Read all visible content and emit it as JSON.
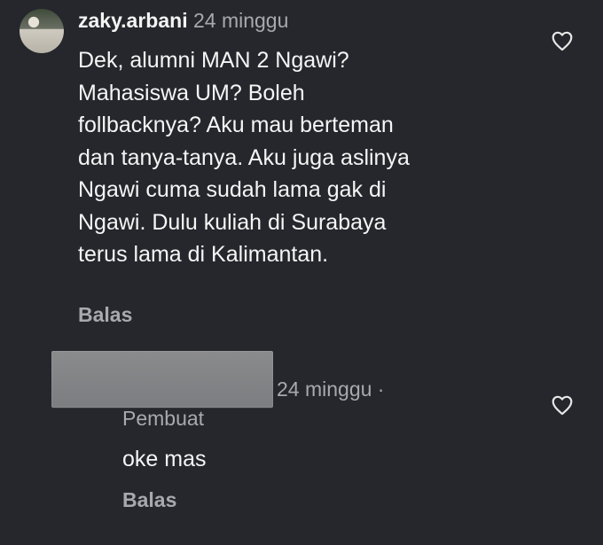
{
  "comment": {
    "username": "zaky.arbani",
    "time": "24 minggu",
    "body_lines": [
      "Dek, alumni MAN 2 Ngawi?",
      "Mahasiswa UM? Boleh",
      "follbacknya? Aku mau berteman",
      "dan tanya-tanya. Aku juga aslinya",
      "Ngawi cuma sudah lama gak di",
      "Ngawi. Dulu kuliah di Surabaya",
      "terus lama di Kalimantan."
    ],
    "reply_label": "Balas",
    "like_icon": "heart-outline-icon"
  },
  "reply": {
    "username_redacted": true,
    "time": "24 minggu ·",
    "badge": "Pembuat",
    "body": "oke mas",
    "reply_label": "Balas",
    "like_icon": "heart-outline-icon"
  },
  "colors": {
    "background": "#25272c",
    "primary_text": "#f5f5f5",
    "secondary_text": "#a7a9ae",
    "redaction": "#85868a"
  }
}
